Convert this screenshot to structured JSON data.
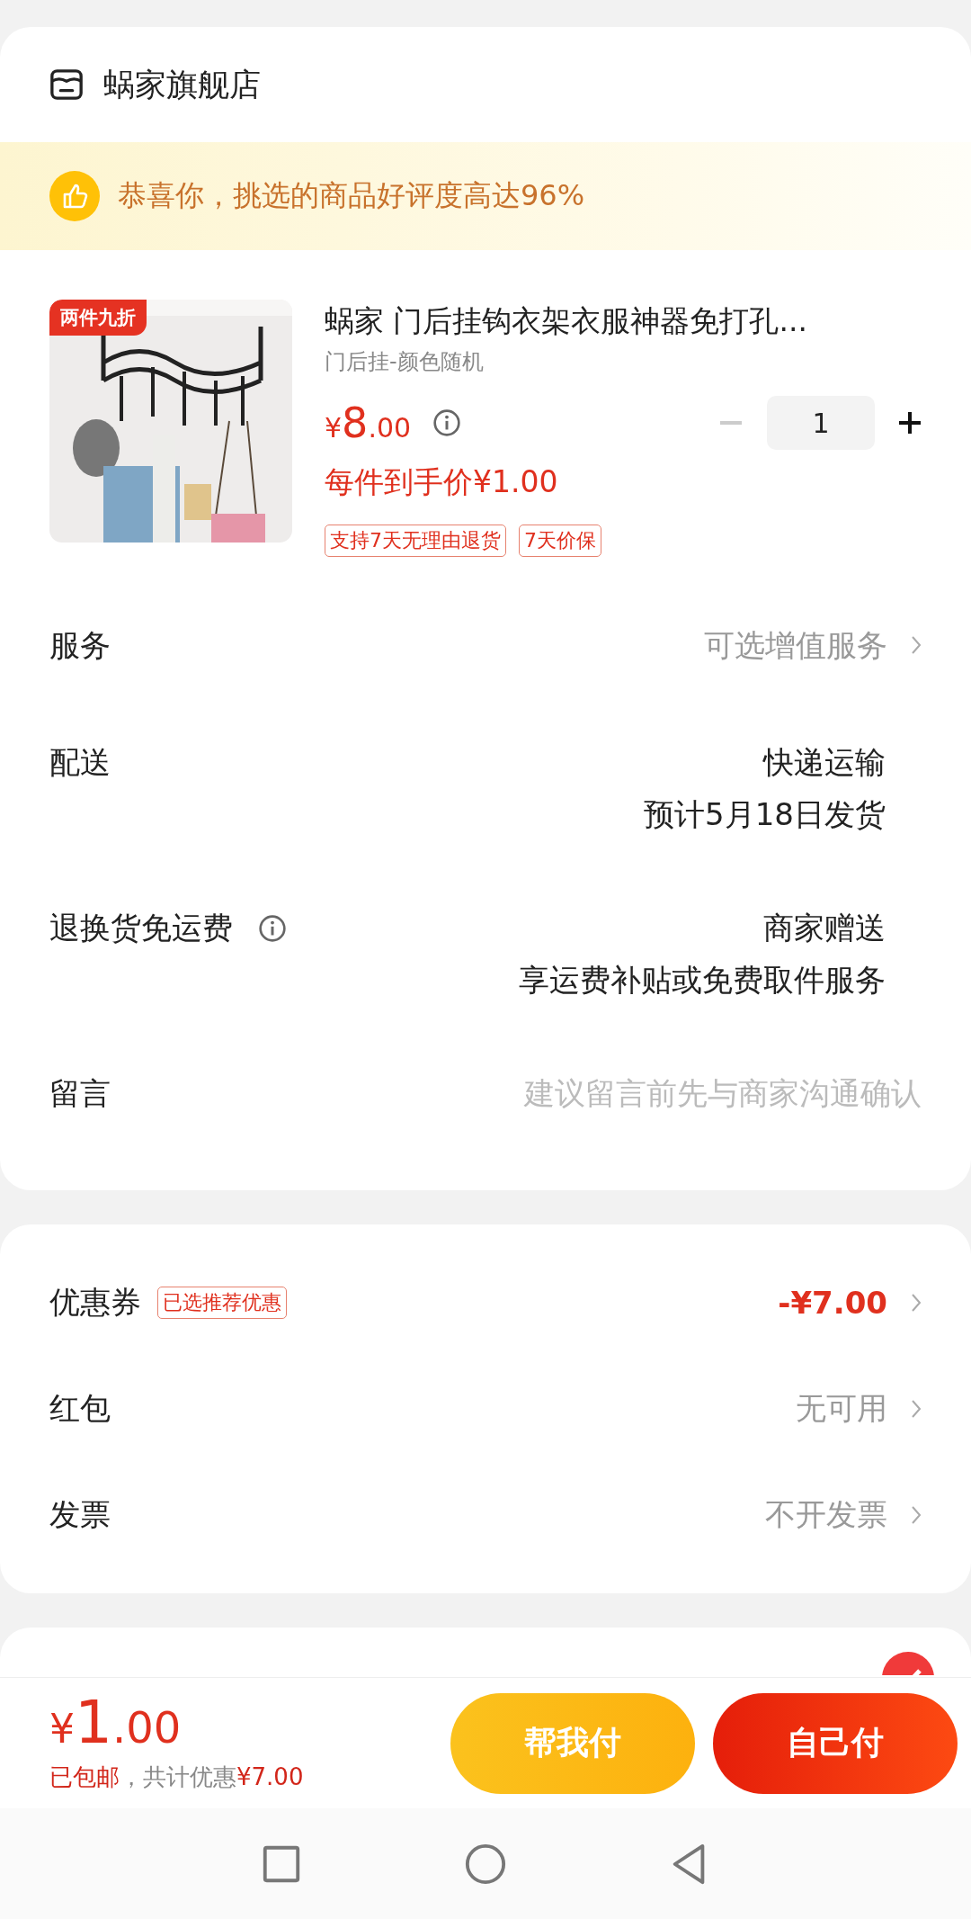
{
  "store": {
    "name": "蜗家旗舰店"
  },
  "banner": {
    "text": "恭喜你，挑选的商品好评度高达96%"
  },
  "product": {
    "badge": "两件九折",
    "title": "蜗家 门后挂钩衣架衣服神器免打孔...",
    "variant": "门后挂-颜色随机",
    "price_symbol": "¥",
    "price_int": "8",
    "price_dec": ".00",
    "unit_price": "每件到手价¥1.00",
    "quantity": "1",
    "minus_disabled": true,
    "tags": [
      "支持7天无理由退货",
      "7天价保"
    ]
  },
  "services": [
    {
      "label": "服务",
      "lines": [
        "可选增值服务"
      ],
      "kind": "link",
      "info": false
    },
    {
      "label": "配送",
      "lines": [
        "快递运输",
        "预计5月18日发货"
      ],
      "kind": "text",
      "info": false
    },
    {
      "label": "退换货免运费",
      "lines": [
        "商家赠送",
        "享运费补贴或免费取件服务"
      ],
      "kind": "text",
      "info": true
    },
    {
      "label": "留言",
      "lines": [
        "建议留言前先与商家沟通确认"
      ],
      "kind": "placeholder",
      "info": false
    }
  ],
  "discounts": [
    {
      "label": "优惠券",
      "tag": "已选推荐优惠",
      "value": "-¥7.00",
      "highlight": true
    },
    {
      "label": "红包",
      "value": "无可用",
      "highlight": false
    },
    {
      "label": "发票",
      "value": "不开发票",
      "highlight": false
    }
  ],
  "payment": {
    "checked": true
  },
  "footer": {
    "total_symbol": "¥",
    "total_int": "1",
    "total_dec": ".00",
    "shipping": "已包邮",
    "saving_label": "，共计优惠",
    "saving": "¥7.00",
    "buttons": [
      {
        "label": "帮我付",
        "kind": "secondary"
      },
      {
        "label": "自己付",
        "kind": "primary"
      }
    ]
  }
}
